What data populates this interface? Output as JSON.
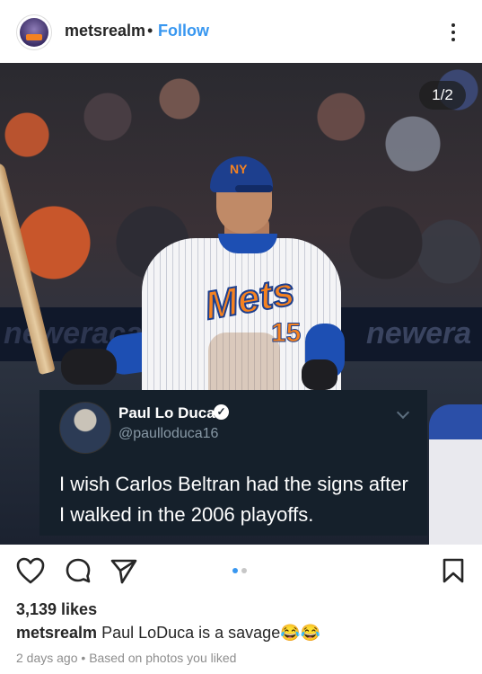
{
  "header": {
    "username": "metsrealm",
    "separator": "•",
    "follow_label": "Follow"
  },
  "photo": {
    "counter": "1/2",
    "wall_text_left": "neweraca",
    "wall_text_right": "newera",
    "jersey_word": "Mets",
    "jersey_number": "15",
    "helmet_logo": "NY"
  },
  "tweet": {
    "name": "Paul Lo Duca",
    "verified": "✓",
    "handle": "@paulloduca16",
    "text": "I wish Carlos Beltran had the signs after I walked in the 2006 playoffs."
  },
  "actions": {
    "icons": [
      "heart-icon",
      "comment-icon",
      "share-icon",
      "bookmark-icon"
    ],
    "pager_active_color": "#3897f0",
    "pager_inactive_color": "#c7c7c7"
  },
  "post": {
    "likes": "3,139 likes",
    "caption_user": "metsrealm",
    "caption_text": "Paul LoDuca is a savage😂😂",
    "time": "2 days ago",
    "meta_separator": "•",
    "meta_note": "Based on photos you liked"
  }
}
